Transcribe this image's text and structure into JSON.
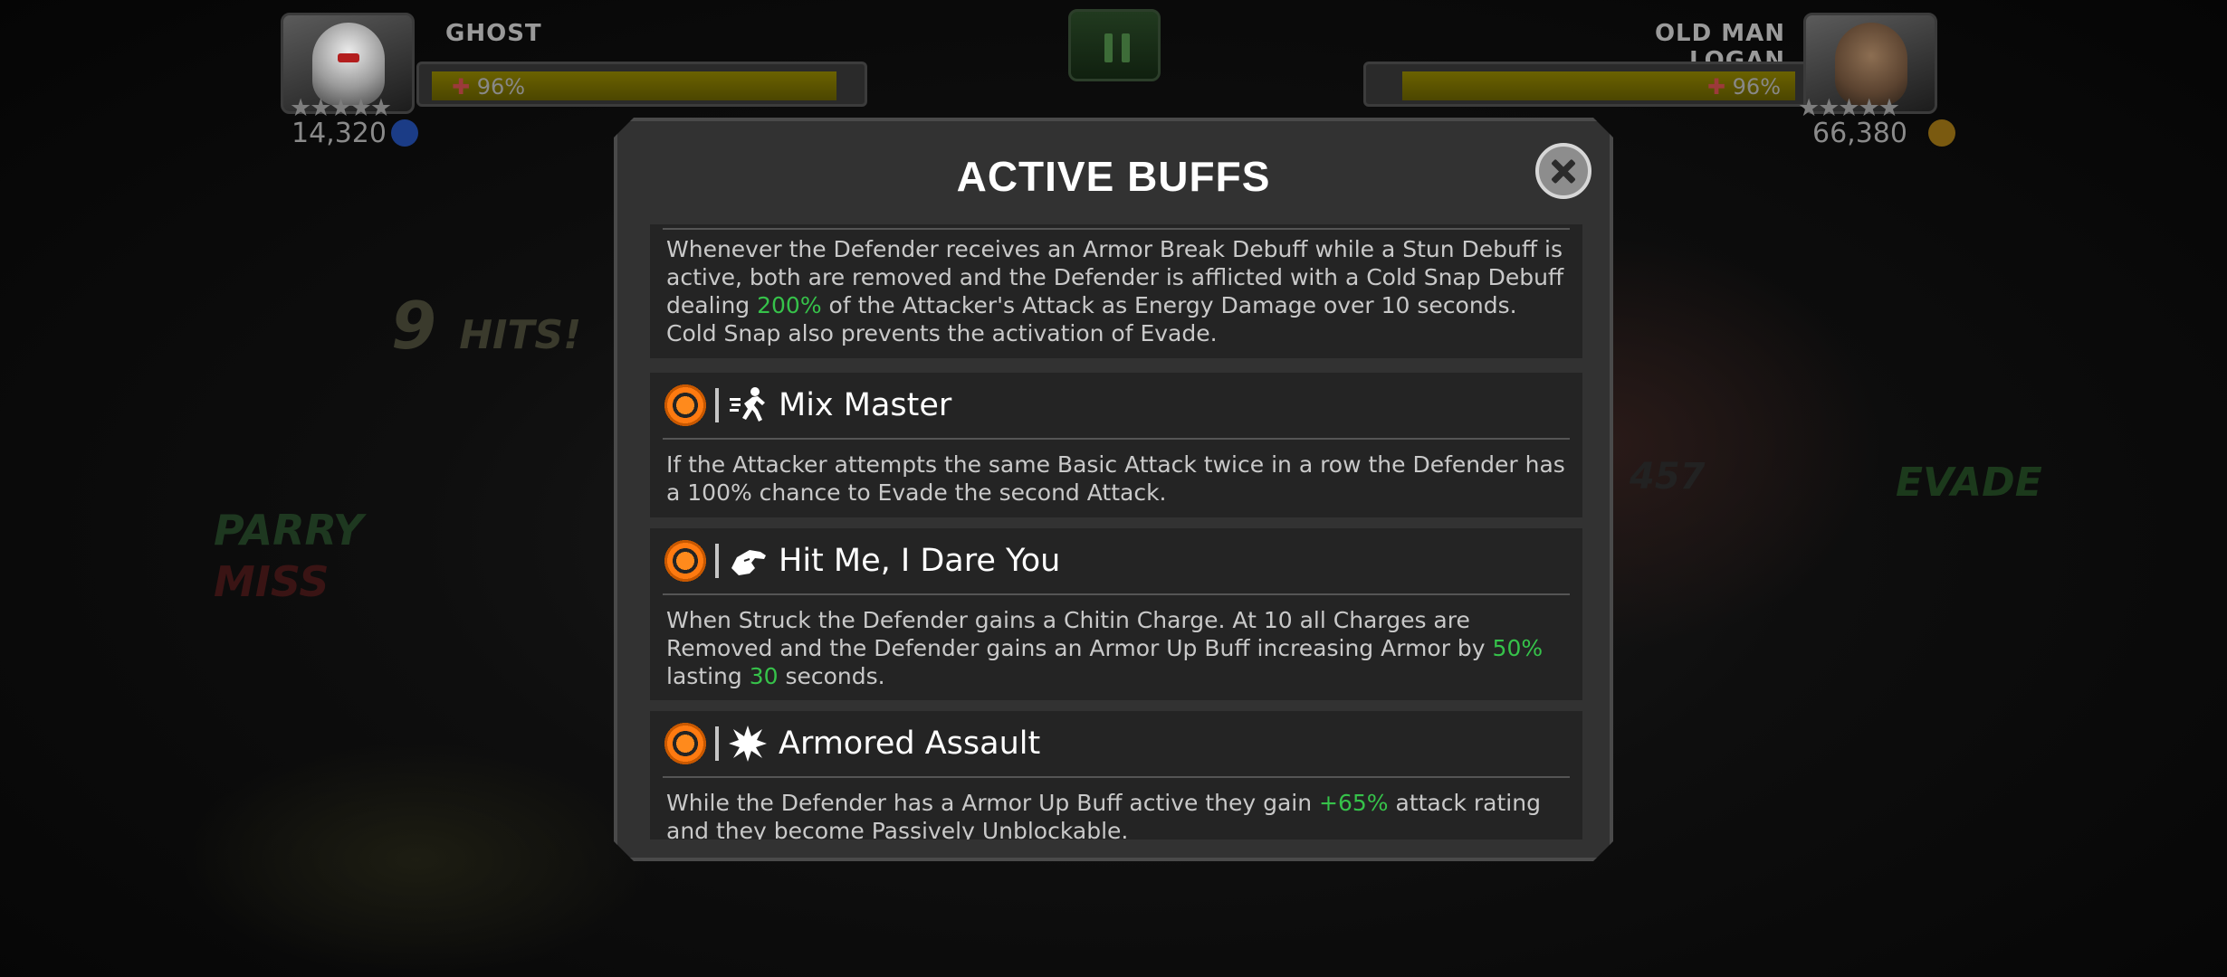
{
  "hud": {
    "left": {
      "name": "GHOST",
      "health_pct": "96%",
      "stars": "★★★★★",
      "rating": "14,320",
      "health_fraction": 0.96
    },
    "right": {
      "name": "OLD MAN LOGAN",
      "health_pct": "96%",
      "stars": "★★★★★",
      "rating": "66,380",
      "health_fraction": 0.96
    },
    "pause_icon": "pause-icon"
  },
  "background": {
    "combo_count": "9",
    "combo_label": "HITS!",
    "parry": "PARRY",
    "miss": "MISS",
    "evade": "EVADE",
    "damage": "457"
  },
  "modal": {
    "title": "ACTIVE BUFFS",
    "close_icon": "close-icon",
    "buffs": [
      {
        "title": "",
        "body_parts": [
          "Whenever the Defender receives an Armor Break Debuff while a Stun Debuff is active, both are removed and the Defender is afflicted with a Cold Snap Debuff dealing ",
          "200%",
          " of the Attacker's Attack as Energy Damage over 10 seconds. Cold Snap also prevents the activation of Evade."
        ]
      },
      {
        "title": "Mix Master",
        "icon": "running-figure-icon",
        "body_parts": [
          "If the Attacker attempts the same Basic Attack twice in a row the Defender has a 100% chance to Evade the second Attack."
        ]
      },
      {
        "title": "Hit Me, I Dare You",
        "icon": "pointing-hand-icon",
        "body_parts": [
          "When Struck the Defender gains a Chitin Charge. At 10 all Charges are Removed and the Defender gains an Armor Up Buff increasing Armor by ",
          "50%",
          " lasting ",
          "30",
          " seconds."
        ]
      },
      {
        "title": "Armored Assault",
        "icon": "impact-burst-icon",
        "body_parts": [
          "While the Defender has a Armor Up Buff active they gain ",
          "+65%",
          " attack rating and they become Passively Unblockable."
        ]
      }
    ]
  },
  "colors": {
    "highlight": "#36c24a",
    "buff_orange": "#ff7a10",
    "panel": "#323232",
    "card": "#242424"
  }
}
